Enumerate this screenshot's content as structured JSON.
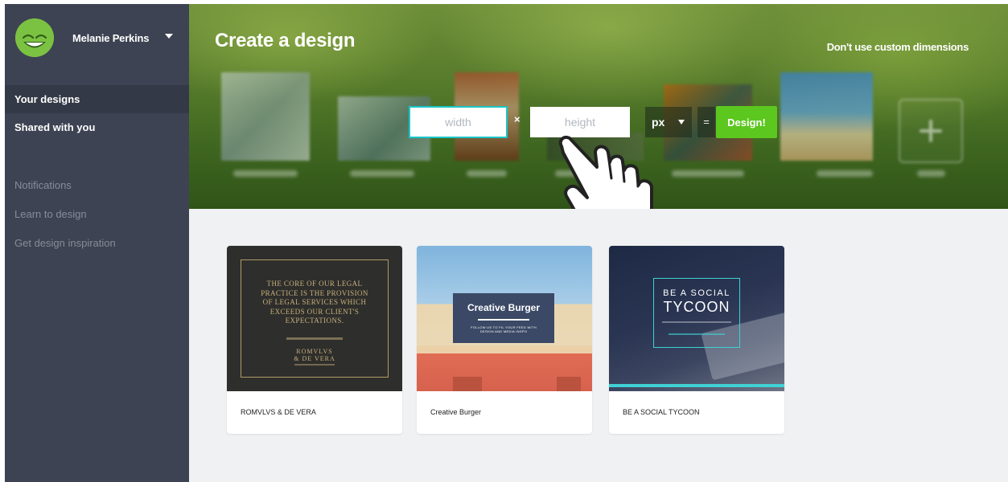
{
  "profile": {
    "name": "Melanie Perkins"
  },
  "nav": {
    "items": [
      {
        "label": "Your designs",
        "active": true
      },
      {
        "label": "Shared with you",
        "active": false
      }
    ],
    "secondary": [
      {
        "label": "Notifications"
      },
      {
        "label": "Learn to design"
      },
      {
        "label": "Get design inspiration"
      }
    ]
  },
  "banner": {
    "title": "Create a design",
    "custom_dims_link": "Don't use custom dimensions",
    "width_placeholder": "width",
    "height_placeholder": "height",
    "times": "×",
    "unit": "px",
    "equals": "=",
    "design_button": "Design!"
  },
  "designs": [
    {
      "title": "ROMVLVS & DE VERA",
      "thumb_text": [
        "THE CORE OF OUR LEGAL",
        "PRACTICE IS THE PROVISION",
        "OF LEGAL SERVICES WHICH",
        "EXCEEDS OUR CLIENT'S",
        "EXPECTATIONS."
      ],
      "thumb_brand": [
        "ROMVLVS",
        "& DE VERA"
      ]
    },
    {
      "title": "Creative Burger",
      "thumb_heading": "Creative Burger",
      "thumb_sub": [
        "FOLLOW US TO FIL YOUR FEED WITH",
        "DESIGN AND MEDIA INSPO"
      ]
    },
    {
      "title": "BE A SOCIAL TYCOON",
      "thumb_line1": "BE A SOCIAL",
      "thumb_line2": "TYCOON"
    }
  ],
  "colors": {
    "sidebar": "#3d4352",
    "accent_teal": "#1bc5c9",
    "design_button": "#5cc71f",
    "content_bg": "#f0f1f2"
  },
  "icons": [
    "caret-down-icon",
    "plus-icon",
    "pointer-hand-icon"
  ]
}
